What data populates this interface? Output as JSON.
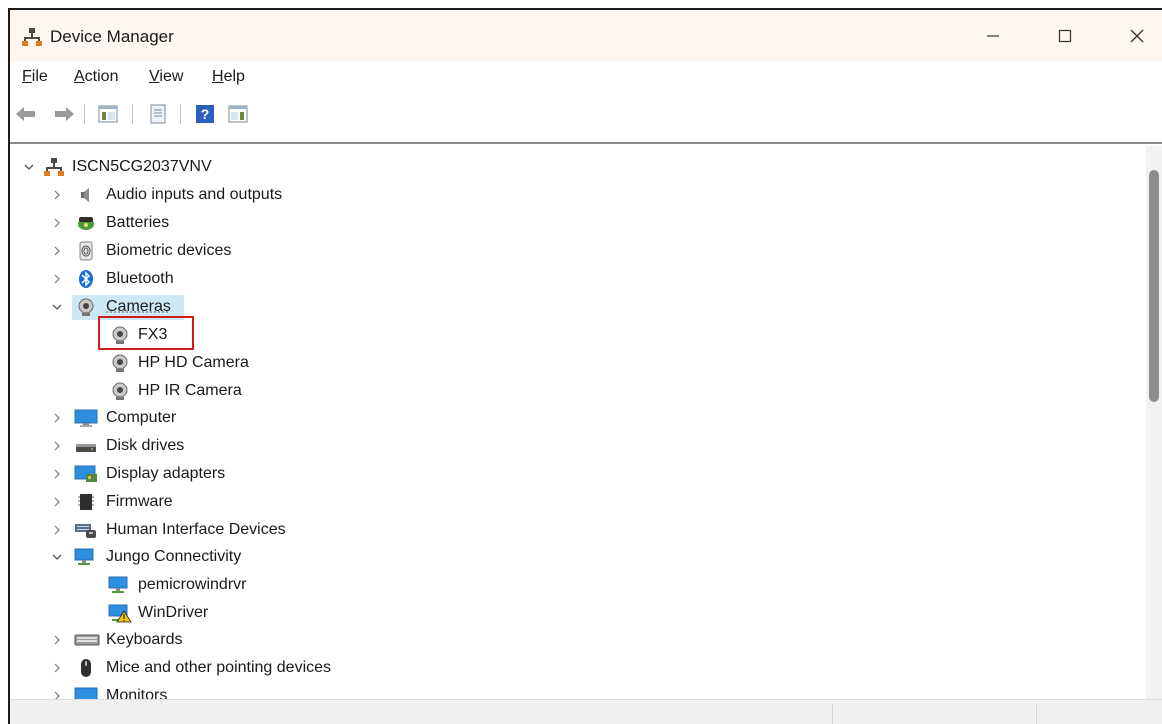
{
  "window": {
    "title": "Device Manager"
  },
  "menu": [
    {
      "label": "File"
    },
    {
      "label": "Action"
    },
    {
      "label": "View"
    },
    {
      "label": "Help"
    }
  ],
  "tree": {
    "root": "ISCN5CG2037VNV",
    "items": [
      {
        "label": "Audio inputs and outputs",
        "icon": "speaker-icon",
        "expanded": false
      },
      {
        "label": "Batteries",
        "icon": "battery-icon",
        "expanded": false
      },
      {
        "label": "Biometric devices",
        "icon": "fingerprint-icon",
        "expanded": false
      },
      {
        "label": "Bluetooth",
        "icon": "bluetooth-icon",
        "expanded": false
      },
      {
        "label": "Cameras",
        "icon": "camera-icon",
        "expanded": true,
        "selected": true,
        "children": [
          {
            "label": "FX3",
            "icon": "camera-icon",
            "highlighted": true
          },
          {
            "label": "HP HD Camera",
            "icon": "camera-icon"
          },
          {
            "label": "HP IR Camera",
            "icon": "camera-icon"
          }
        ]
      },
      {
        "label": "Computer",
        "icon": "monitor-icon",
        "expanded": false
      },
      {
        "label": "Disk drives",
        "icon": "disk-drive-icon",
        "expanded": false
      },
      {
        "label": "Display adapters",
        "icon": "display-adapter-icon",
        "expanded": false
      },
      {
        "label": "Firmware",
        "icon": "firmware-chip-icon",
        "expanded": false
      },
      {
        "label": "Human Interface Devices",
        "icon": "hid-icon",
        "expanded": false
      },
      {
        "label": "Jungo Connectivity",
        "icon": "network-device-icon",
        "expanded": true,
        "children": [
          {
            "label": "pemicrowindrvr",
            "icon": "network-device-icon"
          },
          {
            "label": "WinDriver",
            "icon": "warning-device-icon"
          }
        ]
      },
      {
        "label": "Keyboards",
        "icon": "keyboard-icon",
        "expanded": false
      },
      {
        "label": "Mice and other pointing devices",
        "icon": "mouse-icon",
        "expanded": false
      },
      {
        "label": "Monitors",
        "icon": "monitor-icon",
        "expanded": false
      }
    ]
  },
  "colors": {
    "selection": "#cde8f7",
    "highlight_box": "#d31e1e",
    "titlebar": "#fdf6f1"
  }
}
